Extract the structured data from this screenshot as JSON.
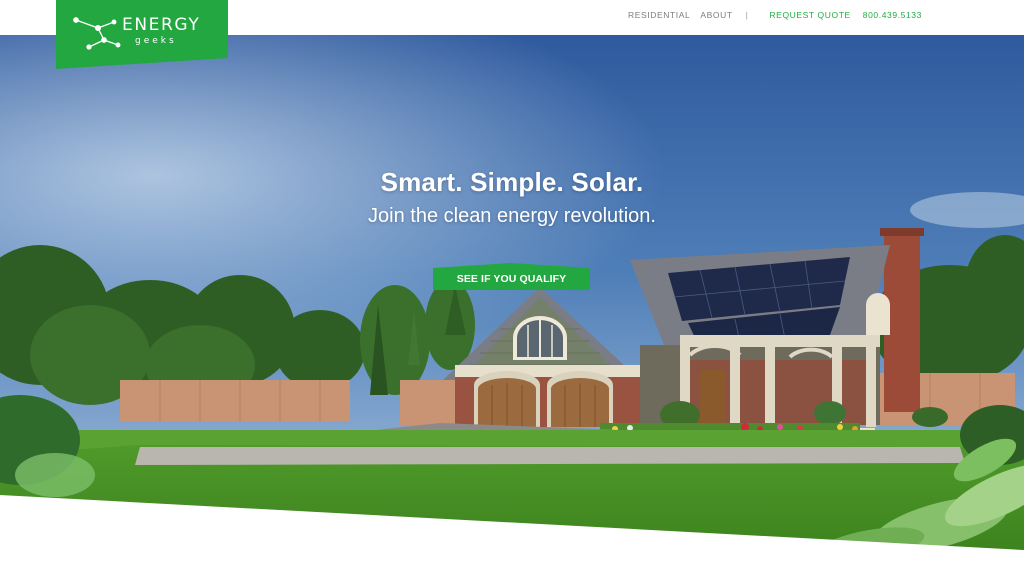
{
  "brand": {
    "name": "ENERGY",
    "tagline": "geeks",
    "color": "#23a740"
  },
  "nav": {
    "items": [
      "RESIDENTIAL",
      "ABOUT"
    ],
    "separator": "|",
    "quote_label": "REQUEST QUOTE",
    "phone": "800.439.5133"
  },
  "hero": {
    "headline": "Smart. Simple. Solar.",
    "subline": "Join the clean energy revolution.",
    "cta_label": "SEE IF YOU QUALIFY"
  },
  "colors": {
    "accent": "#23a740",
    "nav_text": "#7d7d7d",
    "link_green": "#1fad3f"
  }
}
